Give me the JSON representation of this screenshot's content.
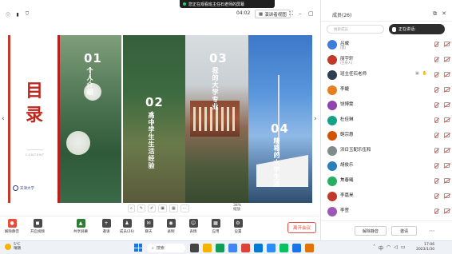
{
  "app": {
    "share_banner": "您正在观看班主任石老师的屏幕",
    "meeting_time": "04:02",
    "view_mode_label": "演讲者视图"
  },
  "slide": {
    "title_chars": [
      "目",
      "录"
    ],
    "content_word": "CONTENT",
    "university": "天津大学",
    "panels": [
      {
        "num": "01",
        "title": "个人介绍"
      },
      {
        "num": "02",
        "title": "高中学生生活经验"
      },
      {
        "num": "03",
        "title": "我的大学专业"
      },
      {
        "num": "04",
        "title": "精彩的大学生活"
      }
    ]
  },
  "slide_toolbar": {
    "zoom_value": "38%",
    "zoom_label": "缩放"
  },
  "controls": [
    {
      "label": "解除静音",
      "icon": "microphone-muted-icon"
    },
    {
      "label": "开启视频",
      "icon": "camera-off-icon"
    },
    {
      "label": "共享屏幕",
      "icon": "screen-share-icon"
    },
    {
      "label": "邀请",
      "icon": "invite-icon"
    },
    {
      "label": "成员(26)",
      "icon": "members-icon"
    },
    {
      "label": "聊天",
      "icon": "chat-icon"
    },
    {
      "label": "录制",
      "icon": "record-icon"
    },
    {
      "label": "表情",
      "icon": "emoji-icon"
    },
    {
      "label": "应用",
      "icon": "apps-icon"
    },
    {
      "label": "设置",
      "icon": "settings-icon"
    }
  ],
  "end_meeting_label": "离开会议",
  "member_panel": {
    "title": "成员(26)",
    "search_placeholder": "搜索成员",
    "speaking_label": "正在讲话:",
    "members": [
      {
        "name": "吕威",
        "sub": "(我)",
        "avatar_color": "#3b7dd8"
      },
      {
        "name": "丽宇轩",
        "sub": "(主持人)",
        "avatar_color": "#c0392b"
      },
      {
        "name": "班主任石老师",
        "sub": "",
        "avatar_color": "#2c3e50"
      },
      {
        "name": "李婕",
        "sub": "",
        "avatar_color": "#e67e22"
      },
      {
        "name": "饶博雯",
        "sub": "",
        "avatar_color": "#8e44ad"
      },
      {
        "name": "杜佳琳",
        "sub": "",
        "avatar_color": "#16a085"
      },
      {
        "name": "鲍宗惠",
        "sub": "",
        "avatar_color": "#d35400"
      },
      {
        "name": "洪日玉配乐伍和",
        "sub": "",
        "avatar_color": "#7f8c8d"
      },
      {
        "name": "胡俊乐",
        "sub": "",
        "avatar_color": "#2980b9"
      },
      {
        "name": "焦春曦",
        "sub": "",
        "avatar_color": "#27ae60"
      },
      {
        "name": "李嘉昊",
        "sub": "",
        "avatar_color": "#c0392b"
      },
      {
        "name": "李萱",
        "sub": "",
        "avatar_color": "#9b59b6"
      }
    ],
    "footer_buttons": [
      "解除静音",
      "邀请"
    ]
  },
  "taskbar": {
    "weather_temp": "5°C",
    "weather_desc": "晴朗",
    "search_label": "搜索",
    "time": "17:06",
    "date": "2023/1/30"
  }
}
